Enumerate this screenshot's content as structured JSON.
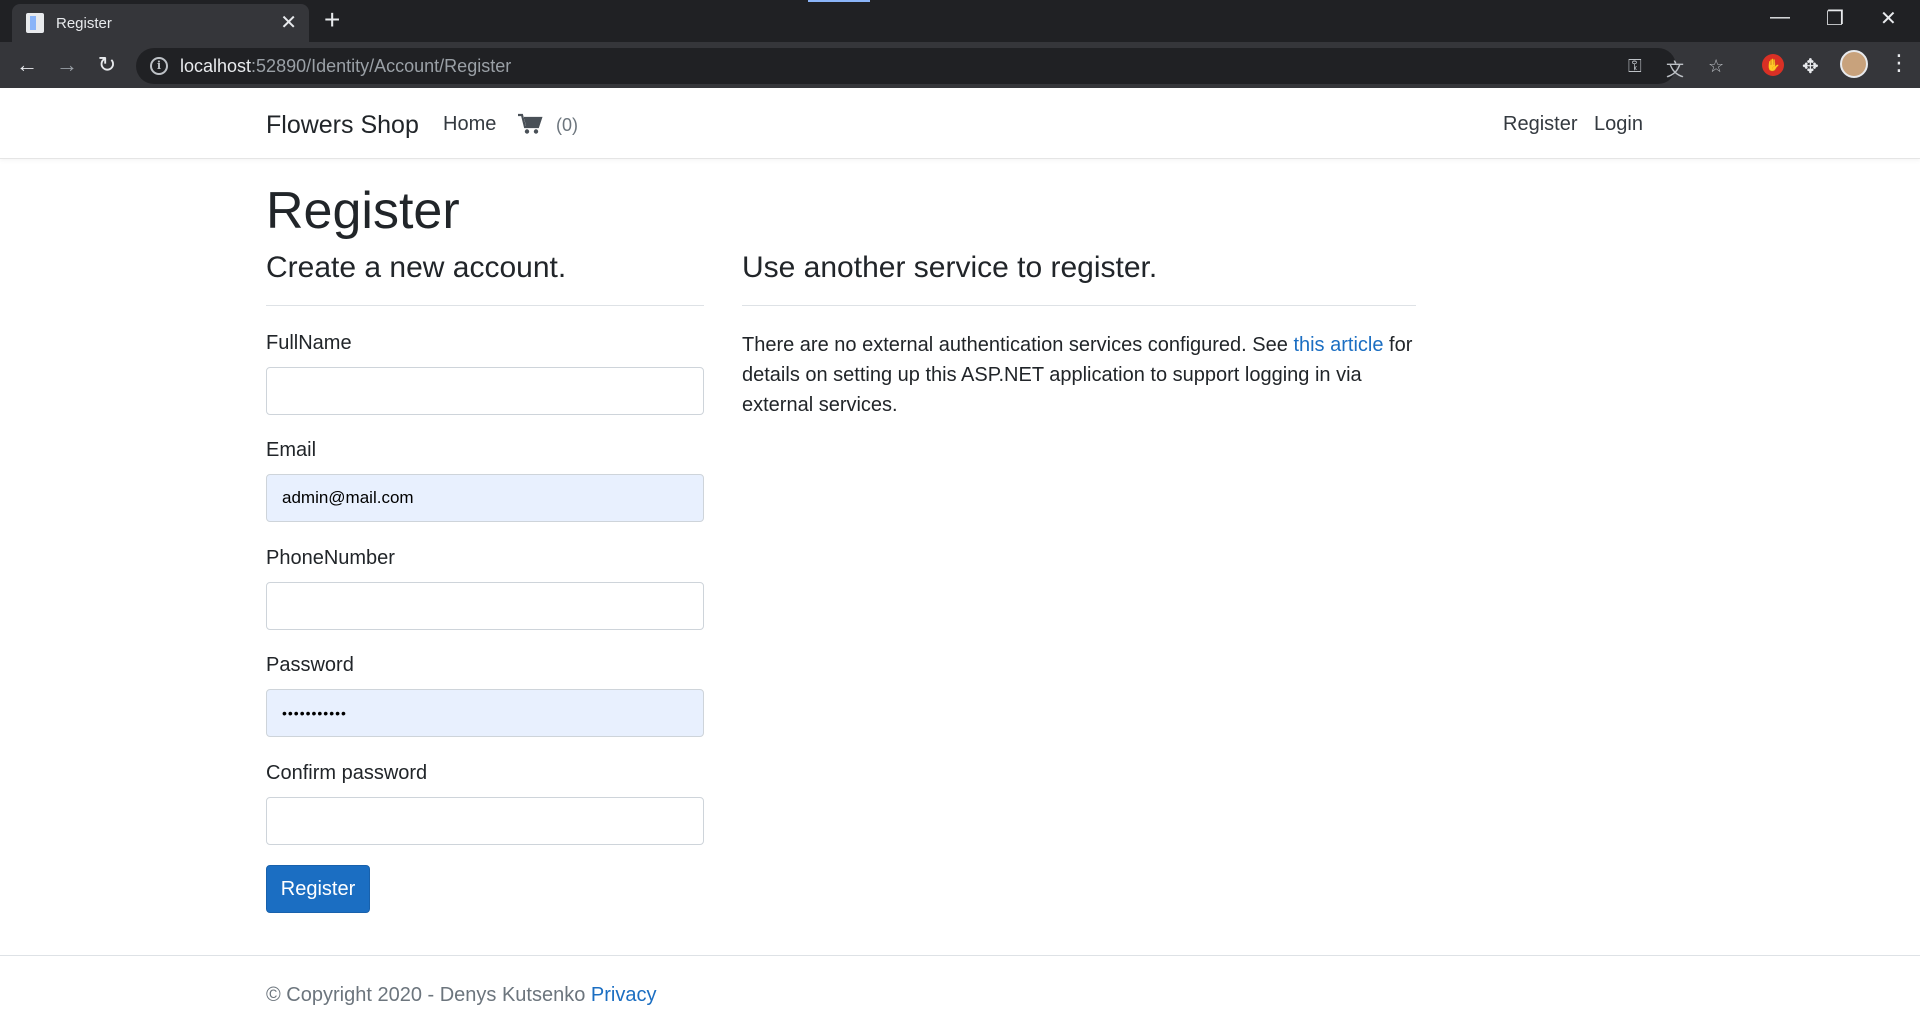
{
  "browser": {
    "tab_title": "Register",
    "url_host": "localhost",
    "url_rest": ":52890/Identity/Account/Register"
  },
  "navbar": {
    "brand": "Flowers Shop",
    "home": "Home",
    "cart_count": "(0)",
    "register": "Register",
    "login": "Login"
  },
  "page": {
    "title": "Register",
    "left_heading": "Create a new account.",
    "right_heading": "Use another service to register."
  },
  "form": {
    "fullname_label": "FullName",
    "fullname_value": "",
    "email_label": "Email",
    "email_value": "admin@mail.com",
    "phone_label": "PhoneNumber",
    "phone_value": "",
    "password_label": "Password",
    "password_value": "•••••••••••",
    "confirm_label": "Confirm password",
    "confirm_value": "",
    "submit_label": "Register"
  },
  "external": {
    "text_before": "There are no external authentication services configured. See ",
    "link": "this article",
    "text_after": " for details on setting up this ASP.NET application to support logging in via external services."
  },
  "footer": {
    "copyright": "© Copyright 2020 - Denys Kutsenko ",
    "privacy": "Privacy"
  },
  "colors": {
    "primary": "#1b6ec2",
    "autofill": "#e8f0fe"
  }
}
